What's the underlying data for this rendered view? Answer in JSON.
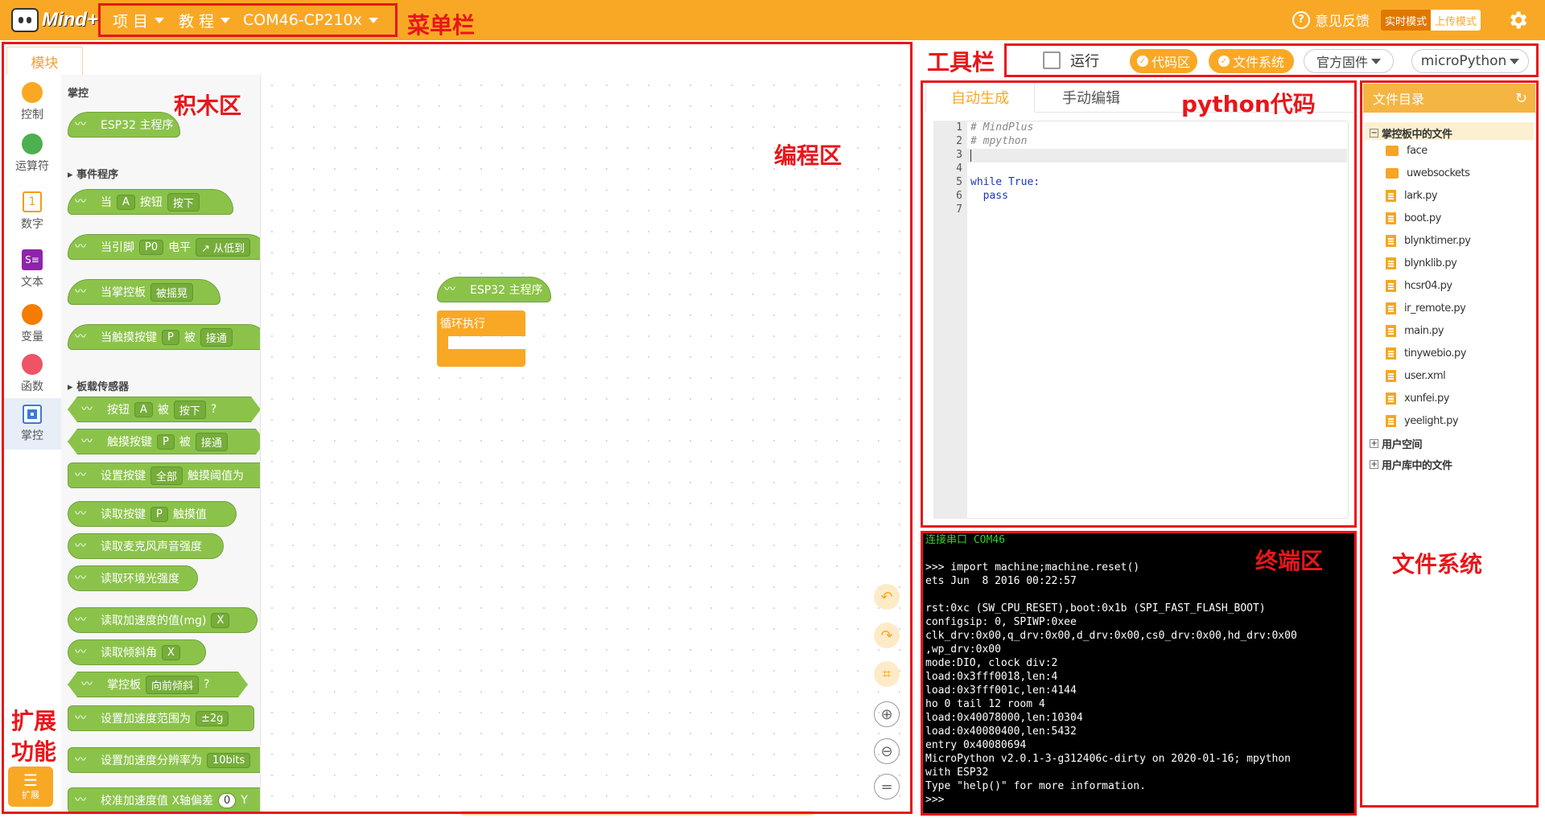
{
  "app": {
    "logo_text": "Mind+"
  },
  "menubar": {
    "project": "项 目",
    "tutorial": "教 程",
    "port": "COM46-CP210x",
    "feedback": "意见反馈",
    "realtime_mode": "实时模式",
    "upload_mode": "上传模式"
  },
  "annotations": {
    "menubar": "菜单栏",
    "toolbar": "工具栏",
    "blocks": "积木区",
    "programming": "编程区",
    "python_code": "python代码",
    "terminal": "终端区",
    "filesystem": "文件系统",
    "extension": "扩展\n功能"
  },
  "left": {
    "tab": "模块",
    "categories": [
      {
        "label": "控制",
        "color": "#f9a825",
        "icon": "dot"
      },
      {
        "label": "运算符",
        "color": "#4caf50",
        "icon": "dot"
      },
      {
        "label": "数字",
        "color": "#f39c12",
        "icon": "number-icon",
        "glyph": "1"
      },
      {
        "label": "文本",
        "color": "#8e24aa",
        "icon": "text-icon",
        "glyph": "S≡"
      },
      {
        "label": "变量",
        "color": "#f57c00",
        "icon": "dot"
      },
      {
        "label": "函数",
        "color": "#ef5366",
        "icon": "dot"
      },
      {
        "label": "掌控",
        "color": "#3a7bd5",
        "icon": "chip-icon"
      }
    ],
    "extension_label": "扩展"
  },
  "palette": {
    "section_main": "掌控",
    "main_block": "ESP32 主程序",
    "section_events": "事件程序",
    "ev1": {
      "a": "当",
      "b": "A",
      "c": "按钮",
      "d": "按下"
    },
    "ev2": {
      "a": "当引脚",
      "b": "P0",
      "c": "电平",
      "d": "↗ 从低到"
    },
    "ev3": {
      "a": "当掌控板",
      "b": "被摇晃"
    },
    "ev4": {
      "a": "当触摸按键",
      "b": "P",
      "c": "被",
      "d": "接通"
    },
    "section_sensors": "板载传感器",
    "s1": {
      "a": "按钮",
      "b": "A",
      "c": "被",
      "d": "按下",
      "e": "?"
    },
    "s2": {
      "a": "触摸按键",
      "b": "P",
      "c": "被",
      "d": "接通"
    },
    "s3": {
      "a": "设置按键",
      "b": "全部",
      "c": "触摸阈值为"
    },
    "s4": {
      "a": "读取按键",
      "b": "P",
      "c": "触摸值"
    },
    "s5": {
      "a": "读取麦克风声音强度"
    },
    "s6": {
      "a": "读取环境光强度"
    },
    "s7": {
      "a": "读取加速度的值(mg)",
      "b": "X"
    },
    "s8": {
      "a": "读取倾斜角",
      "b": "X"
    },
    "s9": {
      "a": "掌控板",
      "b": "向前倾斜",
      "c": "?"
    },
    "s10": {
      "a": "设置加速度范围为",
      "b": "±2g"
    },
    "s11": {
      "a": "设置加速度分辨率为",
      "b": "10bits"
    },
    "s12": {
      "a": "校准加速度值 X轴偏差",
      "b": "0",
      "c": "Y"
    }
  },
  "workspace": {
    "main_block": "ESP32 主程序",
    "loop_block": "循环执行"
  },
  "toolbar": {
    "run": "运行",
    "code_area": "代码区",
    "file_system": "文件系统",
    "firmware": "官方固件",
    "language": "microPython"
  },
  "python": {
    "tab_auto": "自动生成",
    "tab_manual": "手动编辑",
    "lines": [
      {
        "n": "1",
        "text": "# MindPlus",
        "kind": "comment"
      },
      {
        "n": "2",
        "text": "# mpython",
        "kind": "comment"
      },
      {
        "n": "3",
        "text": "",
        "kind": "plain"
      },
      {
        "n": "4",
        "text": "",
        "kind": "plain"
      },
      {
        "n": "5",
        "text": "while True:",
        "kind": "keyword"
      },
      {
        "n": "6",
        "text": "  pass",
        "kind": "plain"
      },
      {
        "n": "7",
        "text": "",
        "kind": "plain"
      }
    ]
  },
  "terminal": {
    "lines": [
      "连接串口 COM46",
      "",
      ">>> import machine;machine.reset()",
      "ets Jun  8 2016 00:22:57",
      "",
      "rst:0xc (SW_CPU_RESET),boot:0x1b (SPI_FAST_FLASH_BOOT)",
      "configsip: 0, SPIWP:0xee",
      "clk_drv:0x00,q_drv:0x00,d_drv:0x00,cs0_drv:0x00,hd_drv:0x00",
      ",wp_drv:0x00",
      "mode:DIO, clock div:2",
      "load:0x3fff0018,len:4",
      "load:0x3fff001c,len:4144",
      "ho 0 tail 12 room 4",
      "load:0x40078000,len:10304",
      "load:0x40080400,len:5432",
      "entry 0x40080694",
      "MicroPython v2.0.1-3-g312406c-dirty on 2020-01-16; mpython",
      "with ESP32",
      "Type \"help()\" for more information.",
      ">>>"
    ]
  },
  "filesystem": {
    "title": "文件目录",
    "board_folder": "掌控板中的文件",
    "items": [
      {
        "name": "face",
        "type": "folder"
      },
      {
        "name": "uwebsockets",
        "type": "folder"
      },
      {
        "name": "lark.py",
        "type": "file"
      },
      {
        "name": "boot.py",
        "type": "file"
      },
      {
        "name": "blynktimer.py",
        "type": "file"
      },
      {
        "name": "blynklib.py",
        "type": "file"
      },
      {
        "name": "hcsr04.py",
        "type": "file"
      },
      {
        "name": "ir_remote.py",
        "type": "file"
      },
      {
        "name": "main.py",
        "type": "file"
      },
      {
        "name": "tinywebio.py",
        "type": "file"
      },
      {
        "name": "user.xml",
        "type": "file"
      },
      {
        "name": "xunfei.py",
        "type": "file"
      },
      {
        "name": "yeelight.py",
        "type": "file"
      }
    ],
    "user_space": "用户空间",
    "user_lib": "用户库中的文件"
  }
}
